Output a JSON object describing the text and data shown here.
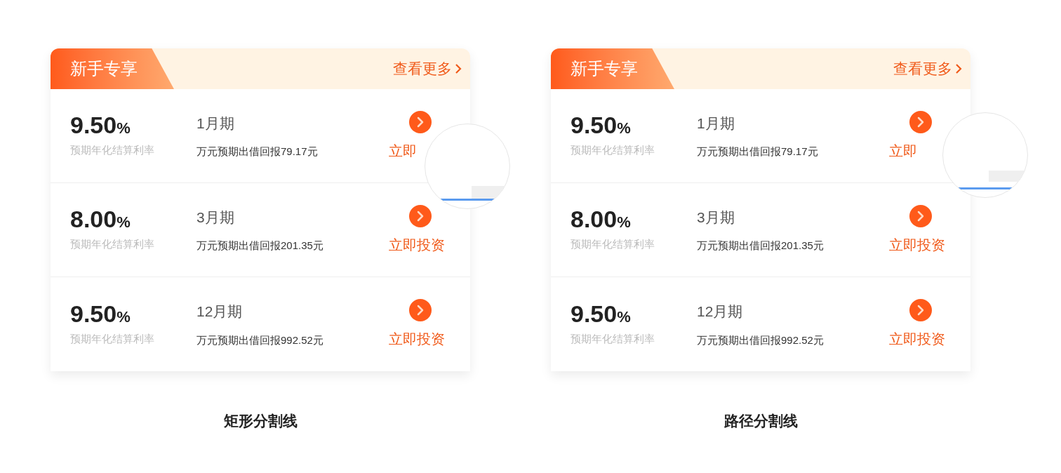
{
  "cards": [
    {
      "header": {
        "title": "新手专享",
        "more": "查看更多"
      },
      "rows": [
        {
          "rate": "9.50",
          "percent": "%",
          "rate_label": "预期年化结算利率",
          "term": "1月期",
          "return_text": "万元预期出借回报79.17元",
          "action": "立即"
        },
        {
          "rate": "8.00",
          "percent": "%",
          "rate_label": "预期年化结算利率",
          "term": "3月期",
          "return_text": "万元预期出借回报201.35元",
          "action": "立即投资"
        },
        {
          "rate": "9.50",
          "percent": "%",
          "rate_label": "预期年化结算利率",
          "term": "12月期",
          "return_text": "万元预期出借回报992.52元",
          "action": "立即投资"
        }
      ],
      "caption": "矩形分割线"
    },
    {
      "header": {
        "title": "新手专享",
        "more": "查看更多"
      },
      "rows": [
        {
          "rate": "9.50",
          "percent": "%",
          "rate_label": "预期年化结算利率",
          "term": "1月期",
          "return_text": "万元预期出借回报79.17元",
          "action": "立即"
        },
        {
          "rate": "8.00",
          "percent": "%",
          "rate_label": "预期年化结算利率",
          "term": "3月期",
          "return_text": "万元预期出借回报201.35元",
          "action": "立即投资"
        },
        {
          "rate": "9.50",
          "percent": "%",
          "rate_label": "预期年化结算利率",
          "term": "12月期",
          "return_text": "万元预期出借回报992.52元",
          "action": "立即投资"
        }
      ],
      "caption": "路径分割线"
    }
  ]
}
